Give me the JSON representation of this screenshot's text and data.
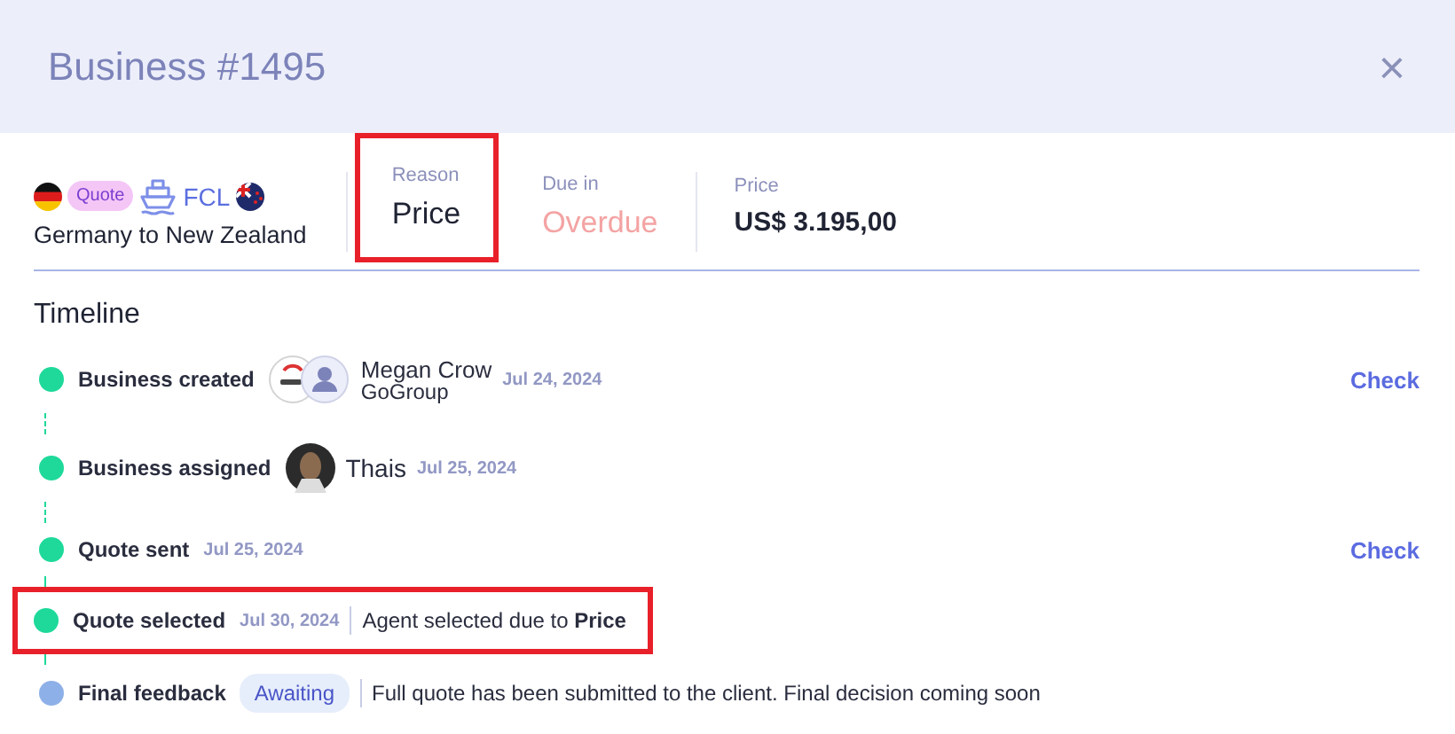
{
  "header": {
    "title": "Business #1495",
    "close": "×"
  },
  "summary": {
    "badge": "Quote",
    "mode": "FCL",
    "route": "Germany to New Zealand",
    "stats": [
      {
        "label": "Reason",
        "value": "Price",
        "kind": "reason",
        "highlighted": true
      },
      {
        "label": "Due in",
        "value": "Overdue",
        "kind": "overdue",
        "highlighted": false
      },
      {
        "label": "Price",
        "value": "US$ 3.195,00",
        "kind": "price",
        "highlighted": false
      }
    ]
  },
  "timeline": {
    "title": "Timeline",
    "events": [
      {
        "label": "Business created",
        "done": true,
        "kind": "company",
        "person": "Megan Crow",
        "company": "GoGroup",
        "date": "Jul 24, 2024",
        "action": "Check",
        "highlighted": false
      },
      {
        "label": "Business assigned",
        "done": true,
        "kind": "agent",
        "person": "Thais",
        "date": "Jul 25, 2024",
        "highlighted": false
      },
      {
        "label": "Quote sent",
        "done": true,
        "kind": "plain",
        "date": "Jul 25, 2024",
        "action": "Check",
        "highlighted": false
      },
      {
        "label": "Quote selected",
        "done": true,
        "kind": "note",
        "date": "Jul 30, 2024",
        "note": "Agent selected due to **Price**",
        "highlighted": true
      },
      {
        "label": "Final feedback",
        "done": false,
        "kind": "badge",
        "badge": "Awaiting",
        "note": "Full quote has been submitted to the client. Final decision coming soon",
        "highlighted": false
      }
    ]
  }
}
